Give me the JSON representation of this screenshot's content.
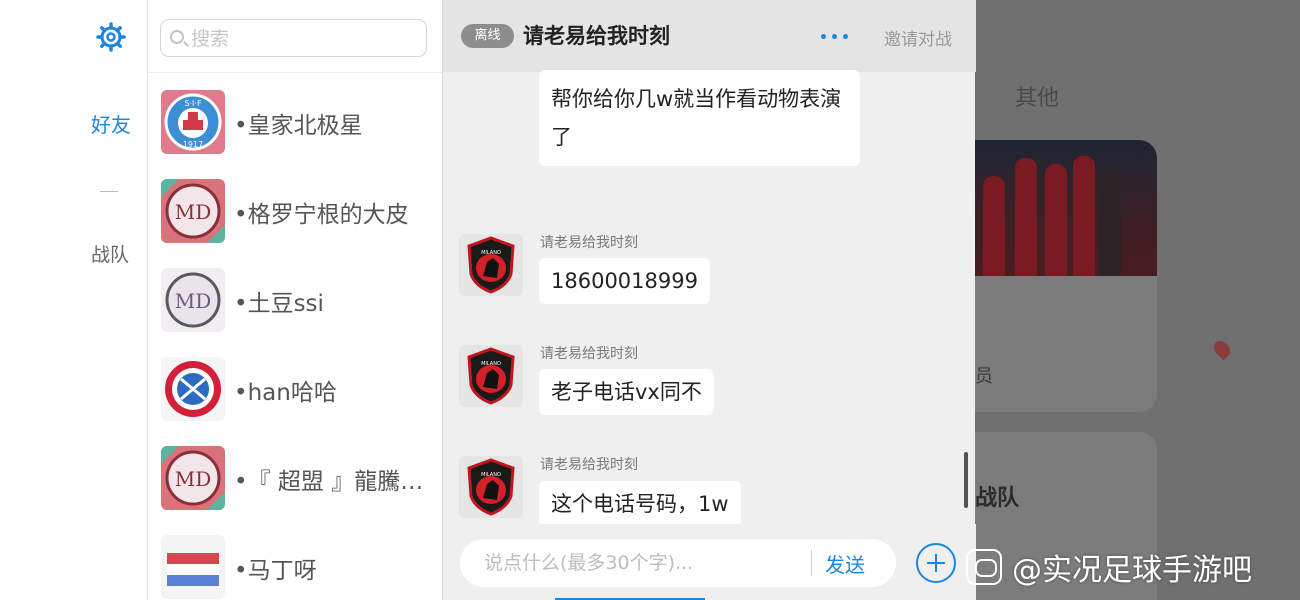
{
  "background": {
    "section_label": "其他",
    "role_fragment": "员",
    "team_fragment": "战队"
  },
  "sidebar": {
    "tabs": [
      {
        "label": "好友",
        "active": true
      },
      {
        "label": "战队",
        "active": false
      }
    ],
    "accent_color": "#1b86e0"
  },
  "search": {
    "placeholder": "搜索",
    "value": ""
  },
  "friends": [
    {
      "name": "•皇家北极星",
      "avatar": "sif-crest"
    },
    {
      "name": "•格罗宁根的大皮",
      "avatar": "md-crest"
    },
    {
      "name": "•土豆ssi",
      "avatar": "md-crest-light"
    },
    {
      "name": "•han哈哈",
      "avatar": "bayern-crest"
    },
    {
      "name": "•『 超盟 』龍騰噬...",
      "avatar": "md-crest"
    },
    {
      "name": "•马丁呀",
      "avatar": "netherlands-flag"
    }
  ],
  "chat": {
    "status_badge": "离线",
    "title": "请老易给我时刻",
    "more_icon": "more-dots-icon",
    "invite_label": "邀请对战",
    "messages": [
      {
        "sender": "",
        "text": "帮你给你几w就当作看动物表演了"
      },
      {
        "sender": "请老易给我时刻",
        "text": "18600018999"
      },
      {
        "sender": "请老易给我时刻",
        "text": "老子电话vx同不"
      },
      {
        "sender": "请老易给我时刻",
        "text": "这个电话号码，1w"
      }
    ],
    "input_placeholder": "说点什么(最多30个字)...",
    "input_value": "",
    "send_label": "发送"
  },
  "watermark": {
    "text": "@实况足球手游吧"
  }
}
